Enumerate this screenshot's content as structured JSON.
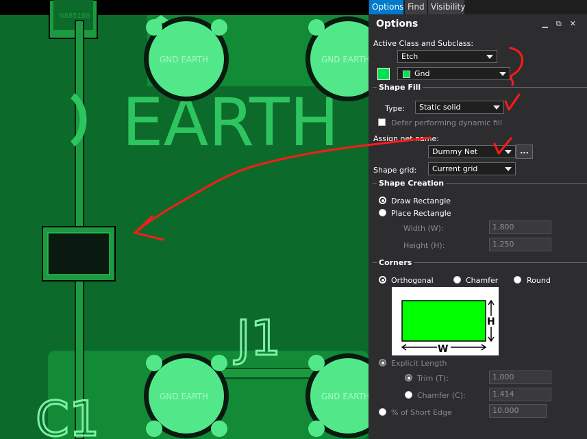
{
  "pcb": {
    "component_label": "N885188",
    "pad_label": "GND EARTH",
    "silk_text_top": "EARTH",
    "silk_ref_j1": "J1",
    "silk_ref_c1": "C1",
    "colors": {
      "board": "#0c6b2a",
      "copper": "#1c9a3f",
      "pad": "#52e88a",
      "silk": "#3ddc6e"
    }
  },
  "tabs": [
    {
      "label": "Options",
      "active": true
    },
    {
      "label": "Find",
      "active": false
    },
    {
      "label": "Visibility",
      "active": false
    }
  ],
  "panel": {
    "title": "Options",
    "active_class_label": "Active Class and Subclass:",
    "class_value": "Etch",
    "subclass_value": "Gnd",
    "subclass_color": "#00e050",
    "shape_fill": {
      "title": "Shape Fill",
      "type_label": "Type:",
      "type_value": "Static solid",
      "defer_label": "Defer performing dynamic fill"
    },
    "assign_net_label": "Assign net name:",
    "net_value": "Dummy Net",
    "net_button": "...",
    "shape_grid_label": "Shape grid:",
    "shape_grid_value": "Current grid",
    "shape_creation": {
      "title": "Shape Creation",
      "draw_rect": "Draw Rectangle",
      "place_rect": "Place Rectangle",
      "width_label": "Width (W):",
      "width_value": "1.800",
      "height_label": "Height (H):",
      "height_value": "1.250"
    },
    "corners": {
      "title": "Corners",
      "orthogonal": "Orthogonal",
      "chamfer": "Chamfer",
      "round": "Round",
      "diagram_h": "H",
      "diagram_w": "W",
      "explicit_length": "Explicit Length",
      "trim_label": "Trim (T):",
      "trim_value": "1.000",
      "chamfer_c_label": "Chamfer (C):",
      "chamfer_c_value": "1.414",
      "short_edge_label": "% of Short Edge",
      "short_edge_value": "10.000"
    }
  }
}
